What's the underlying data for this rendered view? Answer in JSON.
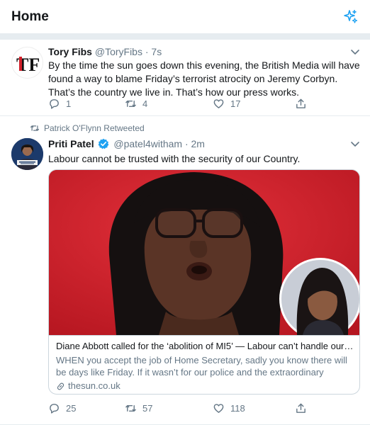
{
  "header": {
    "title": "Home",
    "sparkle_icon": "sparkle-icon"
  },
  "colors": {
    "accent": "#1da1f2",
    "text": "#14171a",
    "muted": "#657786",
    "border": "#e6ecf0",
    "card_red": "#d2202a"
  },
  "tweets": [
    {
      "name": "Tory Fibs",
      "handle": "@ToryFibs",
      "time": "· 7s",
      "avatar_text": "TF",
      "text": "By the time the sun goes down this evening, the British Media will have found a way to blame Friday’s terrorist atrocity on Jeremy Corbyn. That’s the country we live in. That’s how our press works.",
      "replies": "1",
      "retweets": "4",
      "likes": "17"
    },
    {
      "retweeted_by": "Patrick O'Flynn Retweeted",
      "name": "Priti Patel",
      "handle": "@patel4witham",
      "time": "· 2m",
      "verified": true,
      "text": "Labour cannot be trusted with the security of our Country.",
      "card": {
        "title": "Diane Abbott called for the ‘abolition of MI5’ — Labour can’t handle our s...",
        "description": "WHEN you accept the job of Home Secretary, sadly you know there will be days like Friday. If it wasn’t for our police and the extraordinary heroism of...",
        "domain": "thesun.co.uk"
      },
      "replies": "25",
      "retweets": "57",
      "likes": "118"
    }
  ]
}
